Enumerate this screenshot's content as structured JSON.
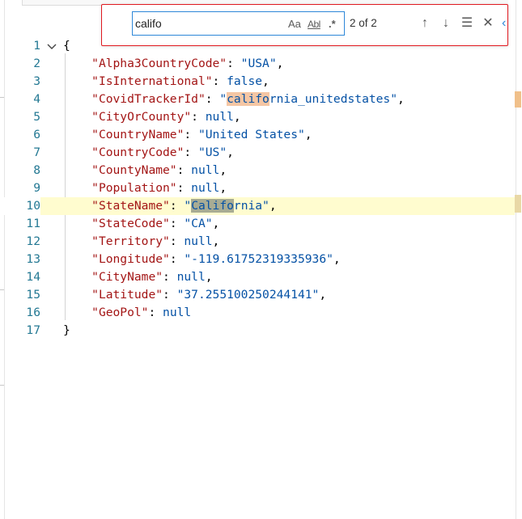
{
  "find": {
    "query": "califo",
    "match_case_label": "Aa",
    "whole_word_label": "Abl",
    "regex_label": ".*",
    "count": "2 of 2"
  },
  "editor": {
    "lines": [
      {
        "no": "1",
        "text": "{"
      },
      {
        "no": "2",
        "text": "\"Alpha3CountryCode\": \"USA\","
      },
      {
        "no": "3",
        "text": "\"IsInternational\": false,"
      },
      {
        "no": "4",
        "text": "\"CovidTrackerId\": \"california_unitedstates\","
      },
      {
        "no": "5",
        "text": "\"CityOrCounty\": null,"
      },
      {
        "no": "6",
        "text": "\"CountryName\": \"United States\","
      },
      {
        "no": "7",
        "text": "\"CountryCode\": \"US\","
      },
      {
        "no": "8",
        "text": "\"CountyName\": null,"
      },
      {
        "no": "9",
        "text": "\"Population\": null,"
      },
      {
        "no": "10",
        "text": "\"StateName\": \"California\","
      },
      {
        "no": "11",
        "text": "\"StateCode\": \"CA\","
      },
      {
        "no": "12",
        "text": "\"Territory\": null,"
      },
      {
        "no": "13",
        "text": "\"Longitude\": \"-119.61752319335936\","
      },
      {
        "no": "14",
        "text": "\"CityName\": null,"
      },
      {
        "no": "15",
        "text": "\"Latitude\": \"37.255100250244141\","
      },
      {
        "no": "16",
        "text": "\"GeoPol\": null"
      },
      {
        "no": "17",
        "text": "}"
      }
    ]
  },
  "colors": {
    "key": "#a31515",
    "value": "#0451a5",
    "match_highlight": "#f5c6a4",
    "current_match": "#a8ac94",
    "current_line": "#fffccf",
    "annotation_border": "#e0191f"
  }
}
